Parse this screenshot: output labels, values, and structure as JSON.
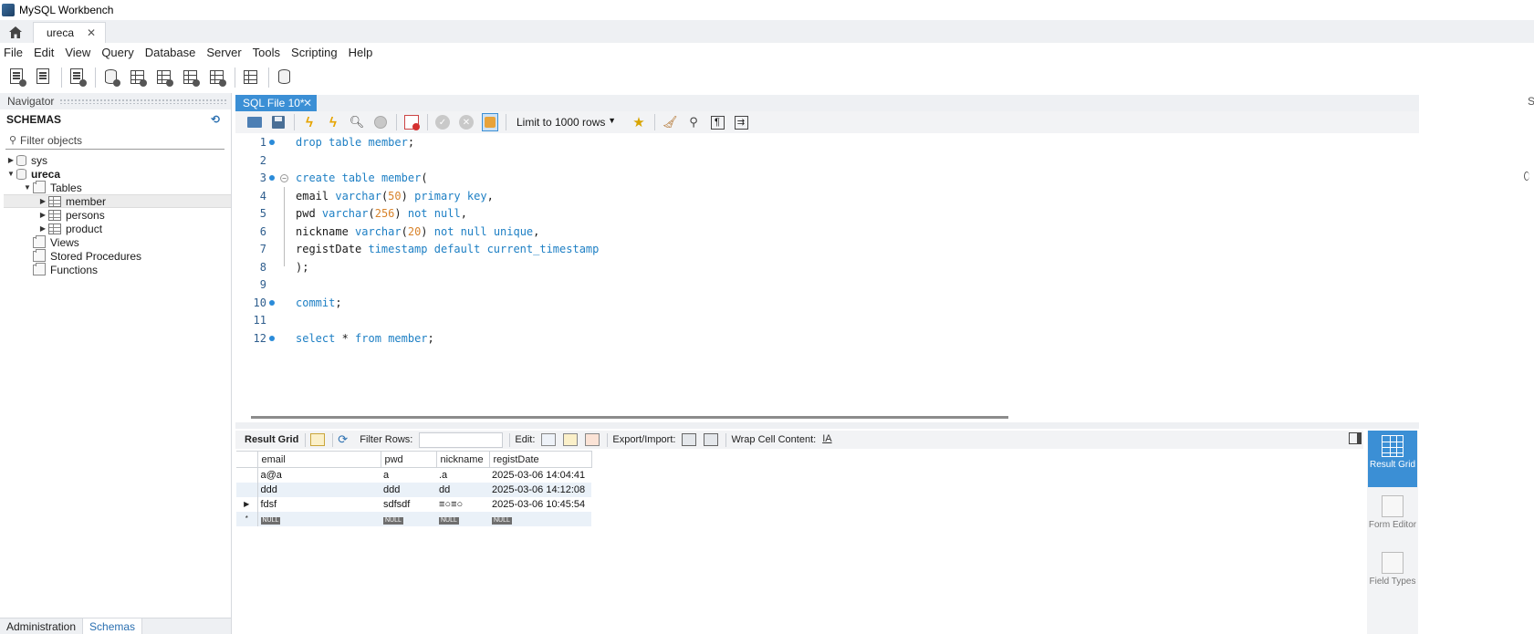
{
  "app": {
    "title": "MySQL Workbench"
  },
  "connection_tab": {
    "label": "ureca",
    "close": "✕"
  },
  "menu": [
    "File",
    "Edit",
    "View",
    "Query",
    "Database",
    "Server",
    "Tools",
    "Scripting",
    "Help"
  ],
  "navigator": {
    "header": "Navigator",
    "schemas_title": "SCHEMAS",
    "filter_placeholder": "Filter objects",
    "tree": {
      "sys": "sys",
      "ureca": "ureca",
      "tables": "Tables",
      "table_items": [
        "member",
        "persons",
        "product"
      ],
      "views": "Views",
      "stored_procedures": "Stored Procedures",
      "functions": "Functions"
    },
    "bottom_tabs": [
      "Administration",
      "Schemas"
    ]
  },
  "editor": {
    "tab_label": "SQL File 10*",
    "tab_close": "✕",
    "limit_label": "Limit to 1000 rows",
    "line_numbers": [
      "1",
      "2",
      "3",
      "4",
      "5",
      "6",
      "7",
      "8",
      "9",
      "10",
      "11",
      "12"
    ]
  },
  "right_stub": "S",
  "result": {
    "toolbar": {
      "result_grid": "Result Grid",
      "filter_rows": "Filter Rows:",
      "edit": "Edit:",
      "export_import": "Export/Import:",
      "wrap": "Wrap Cell Content:"
    },
    "columns": [
      "email",
      "pwd",
      "nickname",
      "registDate"
    ],
    "rows": [
      [
        "a@a",
        "a",
        ".a",
        "2025-03-06 14:04:41"
      ],
      [
        "ddd",
        "ddd",
        "dd",
        "2025-03-06 14:12:08"
      ],
      [
        "fdsf",
        "sdfsdf",
        "≡○≡○",
        "2025-03-06 10:45:54"
      ]
    ],
    "null_label": "NULL",
    "new_row_marker": "*",
    "current_row_marker": "▶"
  },
  "right_rail": {
    "result_grid": "Result Grid",
    "form_editor": "Form Editor",
    "field_types": "Field Types"
  }
}
